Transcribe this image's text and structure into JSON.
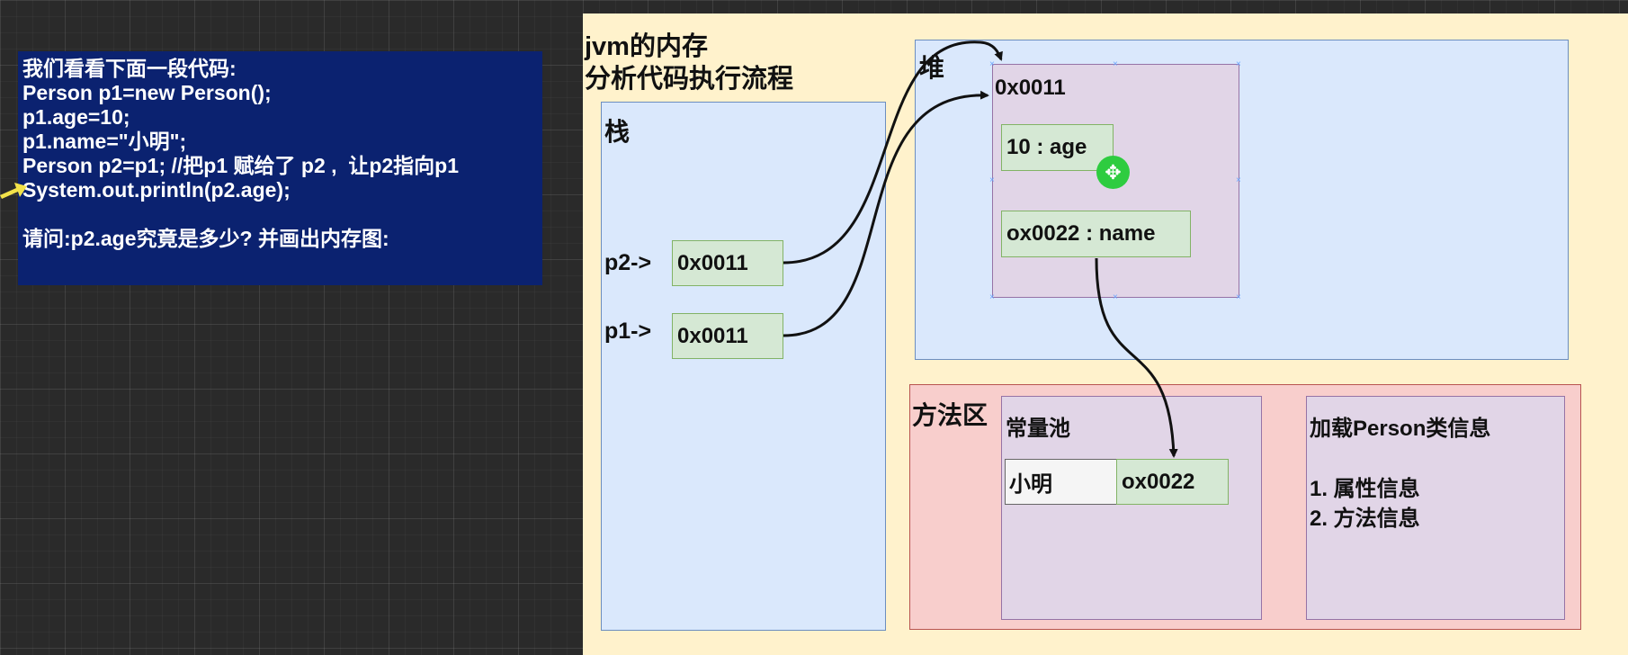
{
  "code_panel": {
    "lines": [
      "我们看看下面一段代码:",
      "Person p1=new Person();",
      "p1.age=10;",
      "p1.name=\"小明\";",
      "Person p2=p1; //把p1 赋给了 p2 ,  让p2指向p1",
      "System.out.println(p2.age);"
    ],
    "question": "请问:p2.age究竟是多少? 并画出内存图:"
  },
  "diagram": {
    "title_line1": "jvm的内存",
    "title_line2": "分析代码执行流程",
    "stack": {
      "label": "栈",
      "p2_label": "p2->",
      "p2_value": "0x0011",
      "p1_label": "p1->",
      "p1_value": "0x0011"
    },
    "heap": {
      "label": "堆",
      "object_address": "0x0011",
      "age_field": "10 : age",
      "name_field": "ox0022 : name"
    },
    "method_area": {
      "label": "方法区",
      "constant_pool": {
        "label": "常量池",
        "string_value": "小明",
        "string_address": "ox0022"
      },
      "class_info": {
        "title": "加载Person类信息",
        "item1": "1. 属性信息",
        "item2": "2. 方法信息"
      }
    },
    "colors": {
      "canvas": "#fff2cc",
      "memory_box": "#dae8fc",
      "object_box": "#e1d5e7",
      "method_area": "#f8cecc",
      "value_cell": "#d5e8d4",
      "code_panel": "#0b2270"
    }
  },
  "icons": {
    "move_cursor": "move-cursor-icon",
    "pointer": "yellow-pointer-arrow-icon"
  }
}
